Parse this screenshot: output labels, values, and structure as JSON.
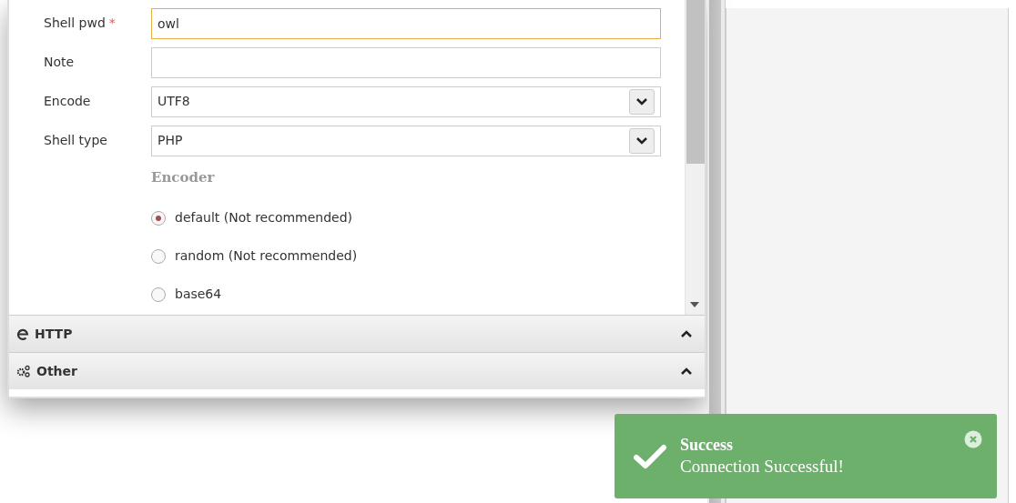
{
  "form": {
    "fields": [
      {
        "kind": "text",
        "label": "Shell pwd",
        "required_mark": "*",
        "value": "owl",
        "focused": true
      },
      {
        "kind": "text",
        "label": "Note",
        "focused": false
      },
      {
        "kind": "select",
        "label": "Encode",
        "value": "UTF8",
        "focused": false
      },
      {
        "kind": "select",
        "label": "Shell type",
        "value": "PHP",
        "focused": false
      }
    ],
    "encoder": {
      "title": "Encoder",
      "options": [
        {
          "label": "default (Not recommended)",
          "selected": true
        },
        {
          "label": "random (Not recommended)",
          "selected": false
        },
        {
          "label": "base64",
          "selected": false
        }
      ]
    }
  },
  "sections": [
    {
      "kind": "http",
      "title": "HTTP"
    },
    {
      "kind": "other",
      "title": "Other"
    }
  ],
  "toast": {
    "title": "Success",
    "message": "Connection Successful!"
  }
}
